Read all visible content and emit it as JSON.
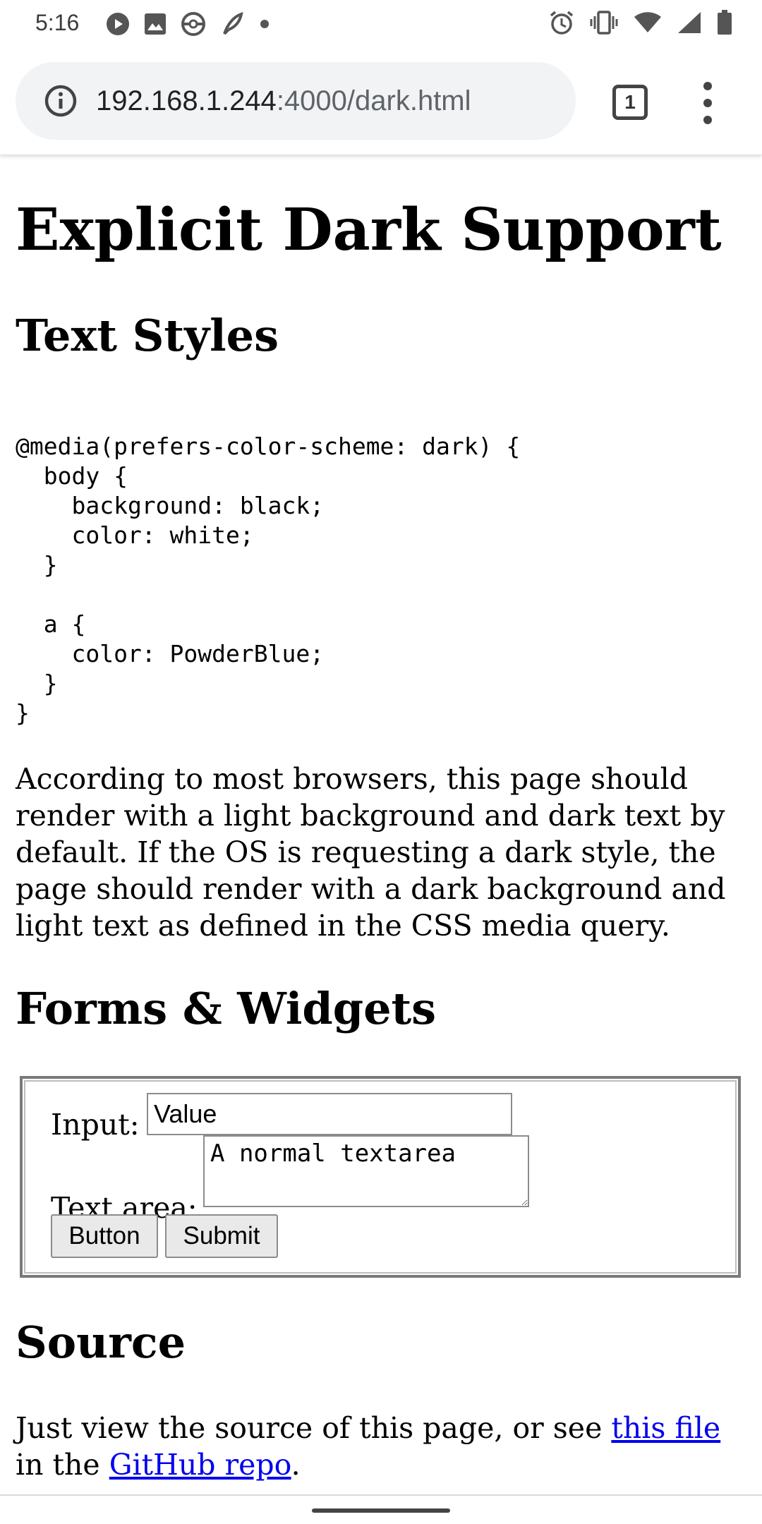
{
  "status_bar": {
    "time": "5:16",
    "left_icons": [
      "play-circle-icon",
      "image-icon",
      "pokeball-icon",
      "feather-icon",
      "dot-icon"
    ],
    "right_icons": [
      "alarm-icon",
      "vibrate-icon",
      "wifi-icon",
      "signal-icon",
      "battery-icon"
    ]
  },
  "browser": {
    "url_host": "192.168.1.244",
    "url_path": ":4000/dark.html",
    "tab_count": "1"
  },
  "page": {
    "title": "Explicit Dark Support",
    "sections": {
      "text_styles": "Text Styles",
      "forms_widgets": "Forms & Widgets",
      "source": "Source"
    },
    "code": "@media(prefers-color-scheme: dark) {\n  body {\n    background: black;\n    color: white;\n  }\n\n  a {\n    color: PowderBlue;\n  }\n}",
    "paragraph": "According to most browsers, this page should render with a light background and dark text by default. If the OS is requesting a dark style, the page should render with a dark background and light text as defined in the CSS media query.",
    "form": {
      "input_label": "Input:",
      "input_value": "Value",
      "textarea_label": "Text area:",
      "textarea_value": "A normal textarea",
      "button_label": "Button",
      "submit_label": "Submit"
    },
    "source_text": {
      "before": "Just view the source of this page, or see ",
      "link1": "this file",
      "middle": " in the ",
      "link2": "GitHub repo",
      "after": "."
    }
  },
  "colors": {
    "link": "#0000ee",
    "omnibox_bg": "#f1f3f4"
  }
}
